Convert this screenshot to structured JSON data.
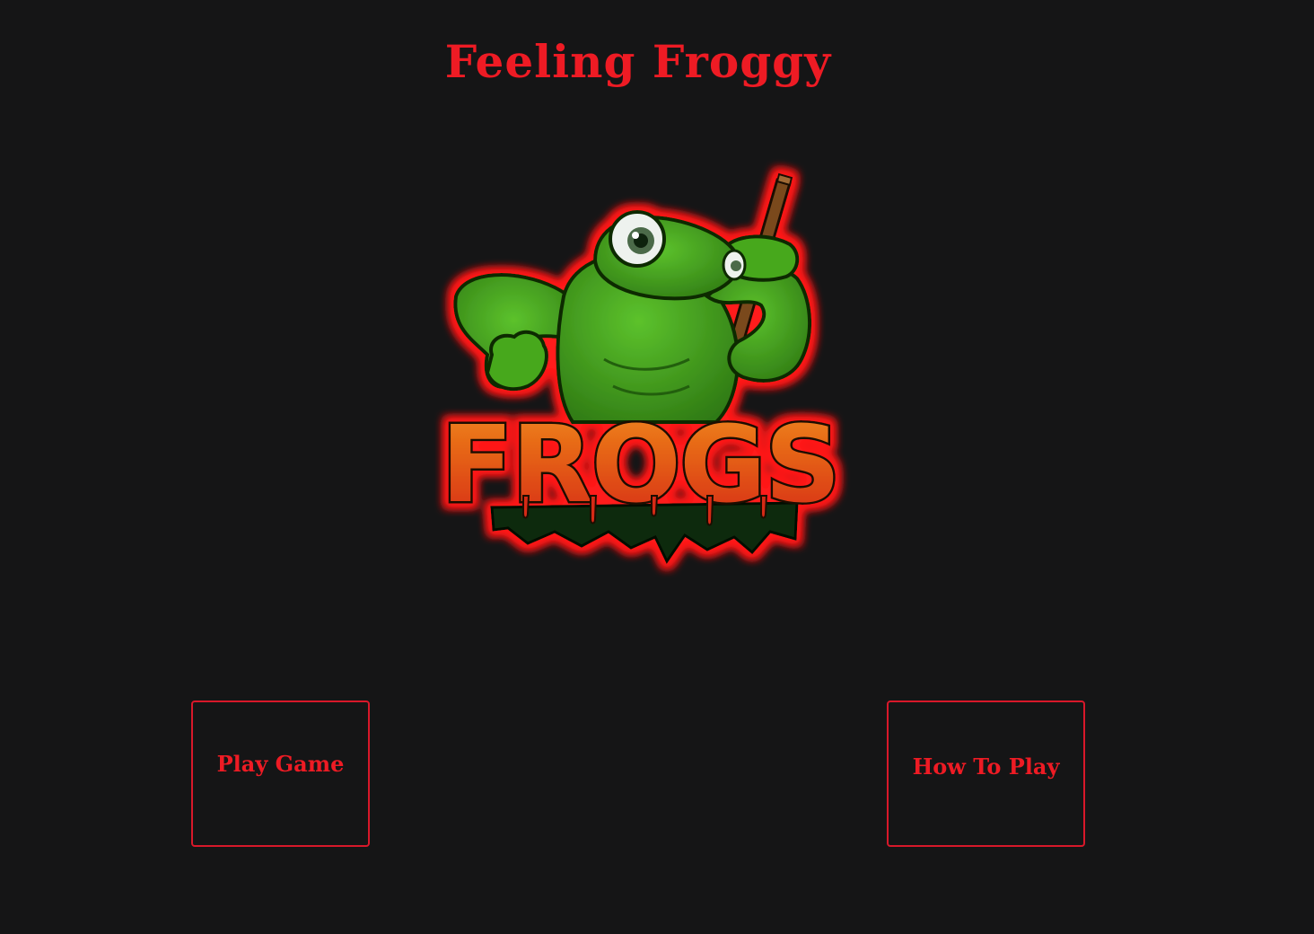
{
  "header": {
    "title": "Feeling Froggy"
  },
  "logo": {
    "wordmark": "FROGS",
    "icon": "frog-mascot-logo-icon"
  },
  "menu": {
    "play_label": "Play Game",
    "howto_label": "How To Play"
  },
  "colors": {
    "background": "#151516",
    "accent": "#ee1b24",
    "frog_green": "#3f9a1f",
    "glow_red": "#ff1a1a",
    "wordmark_top": "#f08a1c",
    "wordmark_bottom": "#d62a12",
    "slime_dark": "#0f2a0a"
  }
}
